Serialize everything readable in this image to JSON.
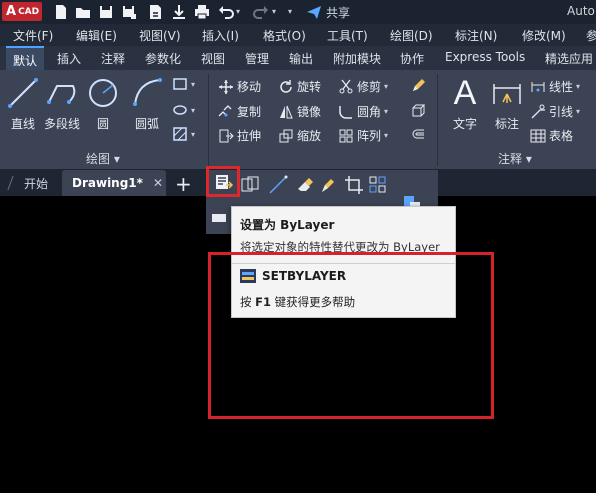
{
  "title_bar": {
    "logo_letter": "A",
    "logo_text": "CAD",
    "share_label": "共享",
    "app_title": "Auto"
  },
  "menu": [
    "文件(F)",
    "编辑(E)",
    "视图(V)",
    "插入(I)",
    "格式(O)",
    "工具(T)",
    "绘图(D)",
    "标注(N)",
    "修改(M)",
    "参"
  ],
  "ribbon_tabs": [
    "默认",
    "插入",
    "注释",
    "参数化",
    "视图",
    "管理",
    "输出",
    "附加模块",
    "协作",
    "Express Tools",
    "精选应用"
  ],
  "ribbon": {
    "draw": {
      "line": "直线",
      "polyline": "多段线",
      "circle": "圆",
      "arc": "圆弧",
      "panel_title": "绘图 ▾"
    },
    "modify": {
      "move": "移动",
      "rotate": "旋转",
      "trim": "修剪",
      "copy": "复制",
      "mirror": "镜像",
      "fillet": "圆角",
      "stretch": "拉伸",
      "scale": "缩放",
      "array": "阵列"
    },
    "annotation": {
      "text": "文字",
      "dimension": "标注",
      "linear": "线性",
      "leader": "引线",
      "table": "表格",
      "panel_title": "注释 ▾"
    }
  },
  "file_tabs": {
    "start": "开始",
    "drawing": "Drawing1*",
    "close": "✕",
    "new": "+"
  },
  "tooltip": {
    "title": "设置为 ByLayer",
    "description": "将选定对象的特性替代更改为 ByLayer",
    "command": "SETBYLAYER",
    "help_prefix": "按 ",
    "help_key": "F1",
    "help_suffix": " 键获得更多帮助"
  },
  "colors": {
    "accent_red": "#d4232a",
    "ribbon_bg": "#3b4355",
    "tooltip_bg": "#f4f4f4"
  }
}
